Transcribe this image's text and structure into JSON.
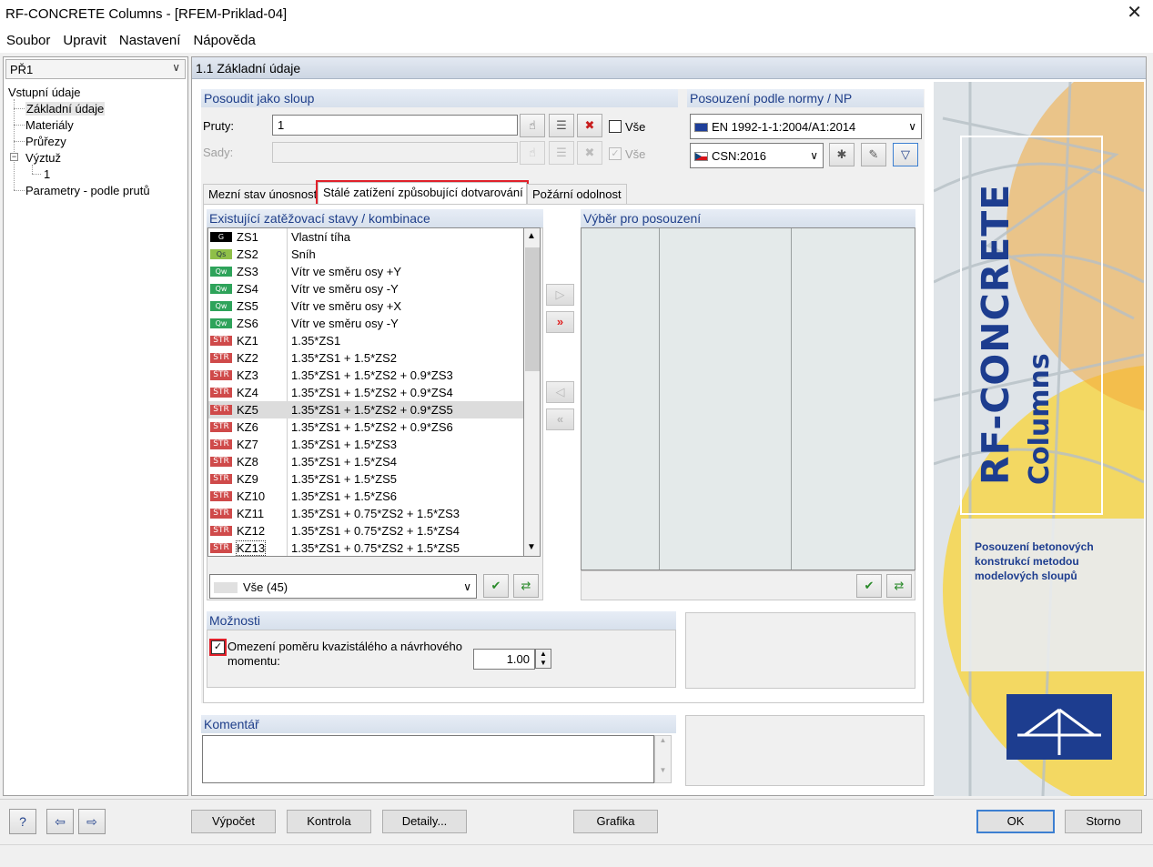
{
  "window": {
    "title": "RF-CONCRETE Columns - [RFEM-Priklad-04]",
    "close_glyph": "✕"
  },
  "menu": [
    "Soubor",
    "Upravit",
    "Nastavení",
    "Nápověda"
  ],
  "left": {
    "case": "PŘ1",
    "tree": {
      "root": "Vstupní údaje",
      "items": [
        "Základní údaje",
        "Materiály",
        "Průřezy",
        "Výztuž",
        "Parametry - podle prutů"
      ],
      "sub_item": "1"
    }
  },
  "section_title": "1.1 Základní údaje",
  "design_as_column": {
    "title": "Posoudit jako sloup",
    "members_label": "Pruty:",
    "members_value": "1",
    "all_label": "Vše",
    "sets_label": "Sady:",
    "sets_all_label": "Vše"
  },
  "norm": {
    "title": "Posouzení podle normy / NP",
    "standard": "EN 1992-1-1:2004/A1:2014",
    "national_annex": "CSN:2016"
  },
  "tabs": [
    "Mezní stav únosnosti",
    "Stálé zatížení způsobující dotvarování",
    "Požární odolnost"
  ],
  "existing": {
    "title": "Existující zatěžovací stavy /  kombinace",
    "rows": [
      {
        "badge": "G",
        "code": "ZS1",
        "desc": "Vlastní tíha"
      },
      {
        "badge": "Qs",
        "code": "ZS2",
        "desc": "Sníh"
      },
      {
        "badge": "Qw",
        "code": "ZS3",
        "desc": "Vítr ve směru osy +Y"
      },
      {
        "badge": "Qw",
        "code": "ZS4",
        "desc": "Vítr ve směru osy -Y"
      },
      {
        "badge": "Qw",
        "code": "ZS5",
        "desc": "Vítr ve směru osy +X"
      },
      {
        "badge": "Qw",
        "code": "ZS6",
        "desc": "Vítr ve směru osy -Y"
      },
      {
        "badge": "STR",
        "code": "KZ1",
        "desc": "1.35*ZS1"
      },
      {
        "badge": "STR",
        "code": "KZ2",
        "desc": "1.35*ZS1 + 1.5*ZS2"
      },
      {
        "badge": "STR",
        "code": "KZ3",
        "desc": "1.35*ZS1 + 1.5*ZS2 + 0.9*ZS3"
      },
      {
        "badge": "STR",
        "code": "KZ4",
        "desc": "1.35*ZS1 + 1.5*ZS2 + 0.9*ZS4"
      },
      {
        "badge": "STR",
        "code": "KZ5",
        "desc": "1.35*ZS1 + 1.5*ZS2 + 0.9*ZS5"
      },
      {
        "badge": "STR",
        "code": "KZ6",
        "desc": "1.35*ZS1 + 1.5*ZS2 + 0.9*ZS6"
      },
      {
        "badge": "STR",
        "code": "KZ7",
        "desc": "1.35*ZS1 + 1.5*ZS3"
      },
      {
        "badge": "STR",
        "code": "KZ8",
        "desc": "1.35*ZS1 + 1.5*ZS4"
      },
      {
        "badge": "STR",
        "code": "KZ9",
        "desc": "1.35*ZS1 + 1.5*ZS5"
      },
      {
        "badge": "STR",
        "code": "KZ10",
        "desc": "1.35*ZS1 + 1.5*ZS6"
      },
      {
        "badge": "STR",
        "code": "KZ11",
        "desc": "1.35*ZS1 + 0.75*ZS2 + 1.5*ZS3"
      },
      {
        "badge": "STR",
        "code": "KZ12",
        "desc": "1.35*ZS1 + 0.75*ZS2 + 1.5*ZS4"
      },
      {
        "badge": "STR",
        "code": "KZ13",
        "desc": "1.35*ZS1 + 0.75*ZS2 + 1.5*ZS5"
      }
    ],
    "selected_code": "KZ5",
    "filter": "Vše (45)"
  },
  "selection": {
    "title": "Výběr pro posouzení"
  },
  "options": {
    "title": "Možnosti",
    "ratio_label_1": "Omezení poměru kvazistálého a návrhového",
    "ratio_label_2": "momentu:",
    "ratio_value": "1.00",
    "checked": true
  },
  "comment": {
    "title": "Komentář",
    "value": ""
  },
  "side_image": {
    "brand": "RF-CONCRETE",
    "sub": "Columns",
    "desc": [
      "Posouzení betonových",
      "konstrukcí metodou",
      "modelových sloupů"
    ]
  },
  "footer": {
    "calc": "Výpočet",
    "check": "Kontrola",
    "details": "Detaily...",
    "graphics": "Grafika",
    "ok": "OK",
    "cancel": "Storno"
  },
  "colors": {
    "accent": "#1f3f8a",
    "highlight": "#e0202a",
    "brand_blue": "#1d3d8f",
    "brand_yellow": "#f7d64a",
    "brand_orange": "#f2a93b"
  },
  "icons": {
    "help": "help-icon",
    "prev": "previous-icon",
    "next": "next-icon",
    "pick": "pick-icon",
    "delete": "delete-icon",
    "filter": "filter-icon"
  }
}
